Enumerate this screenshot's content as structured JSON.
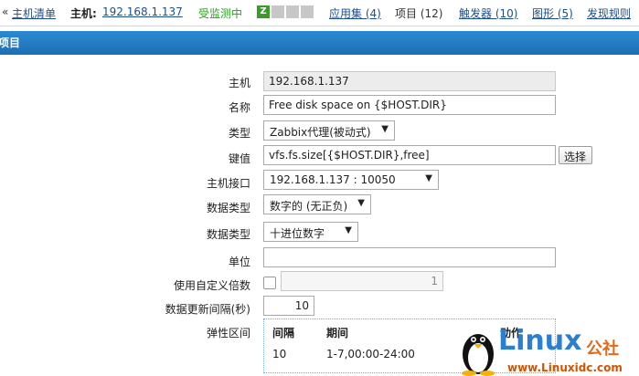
{
  "nav": {
    "back_arrow": "«",
    "host_list": "主机清单",
    "host_label": "主机:",
    "host_ip": "192.168.1.137",
    "monitor_status": "受监测中",
    "tag_z": "Z",
    "applications": "应用集 (4)",
    "items": "项目 (12)",
    "triggers": "触发器 (10)",
    "graphs": "图形 (5)",
    "discovery": "发现规则"
  },
  "section_title": "项目",
  "form": {
    "host_label": "主机",
    "host_value": "192.168.1.137",
    "name_label": "名称",
    "name_value": "Free disk space on {$HOST.DIR}",
    "type_label": "类型",
    "type_value": "Zabbix代理(被动式)",
    "key_label": "键值",
    "key_value": "vfs.fs.size[{$HOST.DIR},free]",
    "key_select_button": "选择",
    "interface_label": "主机接口",
    "interface_value": "192.168.1.137 : 10050",
    "info_type_label": "数据类型",
    "info_type_value": "数字的 (无正负)",
    "data_type_label": "数据类型",
    "data_type_value": "十进位数字",
    "units_label": "单位",
    "units_value": "",
    "multiplier_label": "使用自定义倍数",
    "multiplier_value": "1",
    "delay_label": "数据更新间隔(秒)",
    "delay_value": "10",
    "flex_label": "弹性区间"
  },
  "flex_table": {
    "headers": [
      "间隔",
      "期间",
      "动作"
    ],
    "rows": [
      [
        "10",
        "1-7,00:00-24:00"
      ]
    ]
  },
  "watermark": {
    "brand": "Linux",
    "brand_cn": "公社",
    "url": "www.Linuxidc.com"
  },
  "colors": {
    "title_bar": "#1c6fb4",
    "link": "#1f4e8c",
    "monitored_green": "#22a314",
    "watermark_blue": "#2a7fd0",
    "watermark_orange": "#d35400"
  }
}
